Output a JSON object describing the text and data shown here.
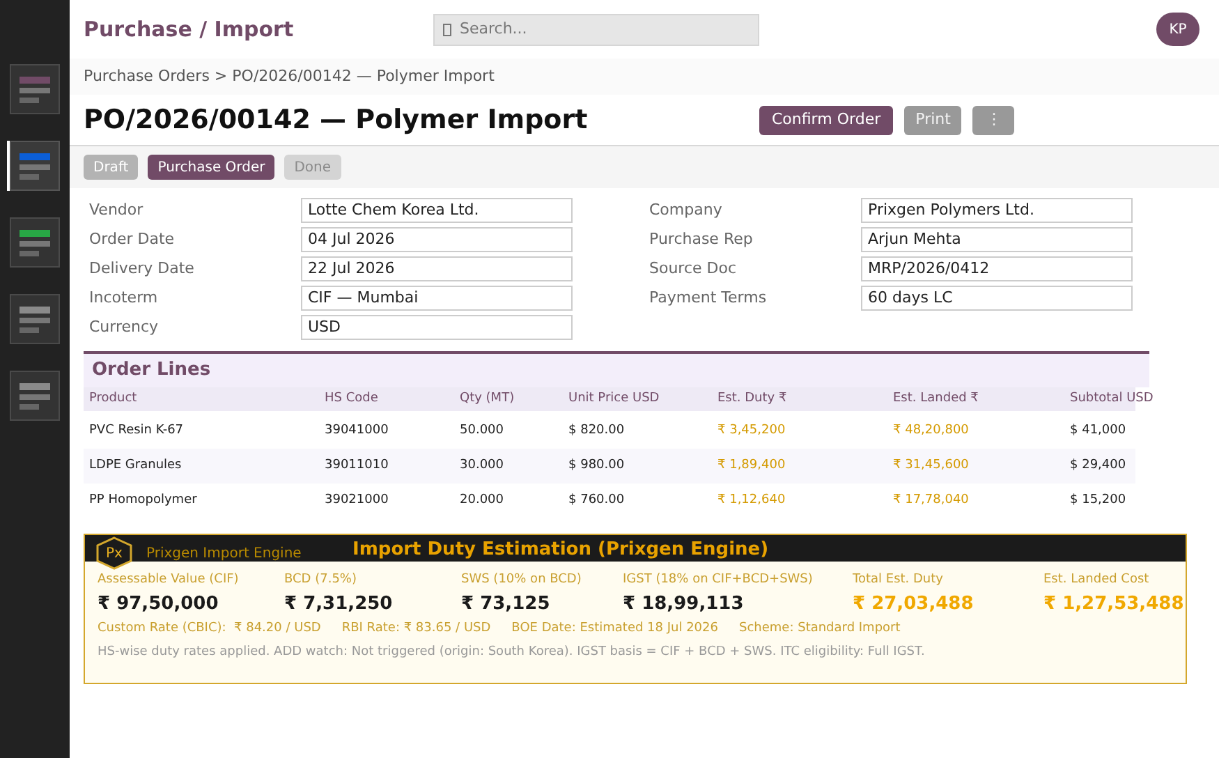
{
  "sidebar": {
    "items": [
      {
        "color": "#714b67",
        "selected": false
      },
      {
        "color": "#0b5ed7",
        "selected": true
      },
      {
        "color": "#28a745",
        "selected": false
      },
      {
        "color": "#8a8a8a",
        "selected": false
      },
      {
        "color": "#8a8a8a",
        "selected": false
      }
    ]
  },
  "header": {
    "app_title": "Purchase / Import",
    "search": {
      "placeholder": "Search..."
    },
    "avatar": "KP"
  },
  "breadcrumb": "Purchase Orders > PO/2026/00142 — Polymer Import",
  "title": "PO/2026/00142 — Polymer Import",
  "actions": [
    {
      "label": "Confirm Order",
      "kind": "primary"
    },
    {
      "label": "Print",
      "kind": "secondary"
    },
    {
      "label": "⋮",
      "kind": "secondary"
    }
  ],
  "stages": [
    {
      "label": "Draft",
      "selected": false,
      "disabled": false
    },
    {
      "label": "Purchase Order",
      "selected": true,
      "disabled": false
    },
    {
      "label": "Done",
      "selected": false,
      "disabled": true
    }
  ],
  "form": {
    "left": [
      {
        "label": "Vendor",
        "value": "Lotte Chem Korea Ltd."
      },
      {
        "label": "Order Date",
        "value": "04 Jul 2026"
      },
      {
        "label": "Delivery Date",
        "value": "22 Jul 2026"
      },
      {
        "label": "Incoterm",
        "value": "CIF — Mumbai"
      },
      {
        "label": "Currency",
        "value": "USD"
      }
    ],
    "right": [
      {
        "label": "Company",
        "value": "Prixgen Polymers Ltd."
      },
      {
        "label": "Purchase Rep",
        "value": "Arjun Mehta"
      },
      {
        "label": "Source Doc",
        "value": "MRP/2026/0412"
      },
      {
        "label": "Payment Terms",
        "value": "60 days LC"
      }
    ]
  },
  "order_lines": {
    "title": "Order Lines",
    "columns": [
      "Product",
      "HS Code",
      "Qty (MT)",
      "Unit Price USD",
      "Est. Duty ₹",
      "Est. Landed ₹",
      "Subtotal USD"
    ],
    "rows": [
      [
        "PVC Resin K-67",
        "39041000",
        "50.000",
        "$ 820.00",
        "₹ 3,45,200",
        "₹ 48,20,800",
        "$ 41,000"
      ],
      [
        "LDPE Granules",
        "39011010",
        "30.000",
        "$ 980.00",
        "₹ 1,89,400",
        "₹ 31,45,600",
        "$ 29,400"
      ],
      [
        "PP Homopolymer",
        "39021000",
        "20.000",
        "$ 760.00",
        "₹ 1,12,640",
        "₹ 17,78,040",
        "$ 15,200"
      ]
    ]
  },
  "duty_panel": {
    "logo": "Px",
    "engine": "Prixgen Import Engine",
    "title": "Import Duty Estimation (Prixgen Engine)",
    "figures": [
      {
        "label": "Assessable Value (CIF)",
        "value": "₹ 97,50,000",
        "highlight": false
      },
      {
        "label": "BCD (7.5%)",
        "value": "₹ 7,31,250",
        "highlight": false
      },
      {
        "label": "SWS (10% on BCD)",
        "value": "₹ 73,125",
        "highlight": false
      },
      {
        "label": "IGST (18% on CIF+BCD+SWS)",
        "value": "₹ 18,99,113",
        "highlight": false
      },
      {
        "label": "Total Est. Duty",
        "value": "₹ 27,03,488",
        "highlight": true
      },
      {
        "label": "Est. Landed Cost",
        "value": "₹ 1,27,53,488",
        "highlight": true
      }
    ],
    "rates": [
      "Custom Rate (CBIC):  ₹ 84.20 / USD",
      "RBI Rate: ₹ 83.65 / USD",
      "BOE Date: Estimated 18 Jul 2026",
      "Scheme: Standard Import"
    ],
    "note": "HS-wise duty rates applied. ADD watch: Not triggered (origin: South Korea). IGST basis = CIF + BCD + SWS. ITC eligibility: Full IGST."
  }
}
